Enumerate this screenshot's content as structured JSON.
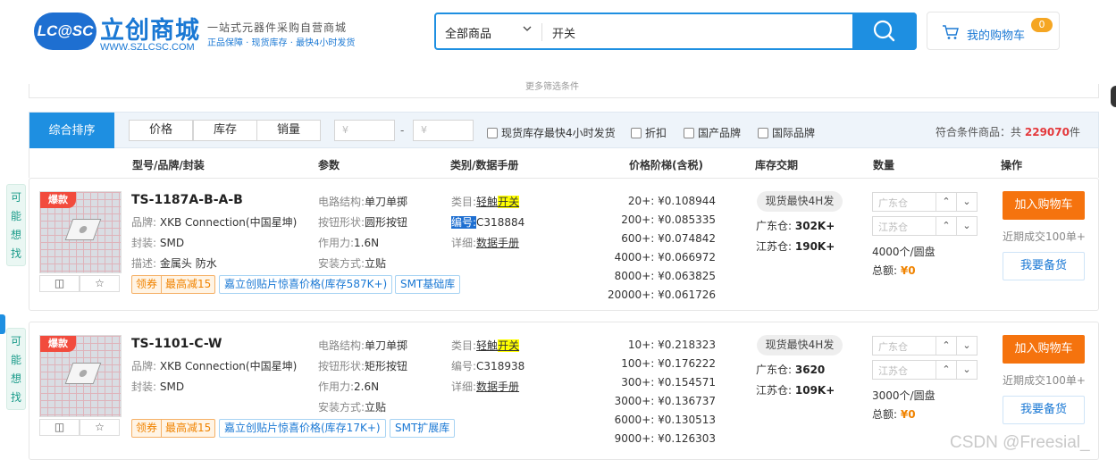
{
  "header": {
    "logo_text": "LC@SC",
    "brand_name": "立创商城",
    "url": "WWW.SZLCSC.COM",
    "slogan": "一站式元器件采购自营商城",
    "slogan_sub": "正品保障 · 现货库存 · 最快4小时发货"
  },
  "search": {
    "category": "全部商品",
    "keyword": "开关"
  },
  "cart": {
    "label": "我的购物车",
    "count": "0"
  },
  "subbar": {
    "more_filters": "更多筛选条件"
  },
  "sortbar": {
    "active": "综合排序",
    "sort_options": [
      "价格",
      "库存",
      "销量"
    ],
    "price_from_placeholder": "¥",
    "price_to_placeholder": "¥",
    "dash": "-",
    "filters": [
      "现货库存最快4小时发货",
      "折扣",
      "国产品牌",
      "国际品牌"
    ],
    "total_prefix": "符合条件商品：共",
    "total_count": "229070",
    "total_suffix": "件"
  },
  "columns": [
    "型号/品牌/封装",
    "参数",
    "类别/数据手册",
    "价格阶梯(含税)",
    "库存交期",
    "数量",
    "操作"
  ],
  "side_panel": {
    "label_lines": [
      "可",
      "能",
      "想",
      "找"
    ]
  },
  "products": [
    {
      "hot": "爆款",
      "part_number": "TS-1187A-B-A-B",
      "brand_label": "品牌:",
      "brand": "XKB Connection(中国星坤)",
      "package_label": "封装:",
      "package": "SMD",
      "desc_label": "描述:",
      "desc": "金属头 防水",
      "params": [
        {
          "k": "电路结构:",
          "v": "单刀单掷"
        },
        {
          "k": "按钮形状:",
          "v": "圆形按钮"
        },
        {
          "k": "作用力:",
          "v": "1.6N"
        },
        {
          "k": "安装方式:",
          "v": "立贴"
        }
      ],
      "category_label": "类目:",
      "category_a": "轻触",
      "category_b": "开关",
      "code_label": "编号:",
      "code": "C318884",
      "datasheet_label": "详细:",
      "datasheet": "数据手册",
      "price_tiers": [
        "20+: ¥0.108944",
        "200+: ¥0.085335",
        "600+: ¥0.074842",
        "4000+: ¥0.066972",
        "8000+: ¥0.063825",
        "20000+: ¥0.061726"
      ],
      "stock_pill": "现货最快4H发",
      "gd_label": "广东仓:",
      "gd_stock": "302K+",
      "js_label": "江苏仓:",
      "js_stock": "190K+",
      "qty_gd_placeholder": "广东仓",
      "qty_js_placeholder": "江苏仓",
      "pack": "4000个/圆盘",
      "sum_label": "总额:",
      "sum": "¥0",
      "coupon_a": "领券",
      "coupon_b": "最高减15",
      "tag1": "嘉立创贴片惊喜价格(库存587K+)",
      "tag2": "SMT基础库",
      "add_cart": "加入购物车",
      "recent": "近期成交100单+",
      "prebook": "我要备货"
    },
    {
      "hot": "爆款",
      "part_number": "TS-1101-C-W",
      "brand_label": "品牌:",
      "brand": "XKB Connection(中国星坤)",
      "package_label": "封装:",
      "package": "SMD",
      "params": [
        {
          "k": "电路结构:",
          "v": "单刀单掷"
        },
        {
          "k": "按钮形状:",
          "v": "矩形按钮"
        },
        {
          "k": "作用力:",
          "v": "2.6N"
        },
        {
          "k": "安装方式:",
          "v": "立贴"
        }
      ],
      "category_label": "类目:",
      "category_a": "轻触",
      "category_b": "开关",
      "code_label": "编号:",
      "code": "C318938",
      "datasheet_label": "详细:",
      "datasheet": "数据手册",
      "price_tiers": [
        "10+: ¥0.218323",
        "100+: ¥0.176222",
        "300+: ¥0.154571",
        "3000+: ¥0.136737",
        "6000+: ¥0.130513",
        "9000+: ¥0.126303"
      ],
      "stock_pill": "现货最快4H发",
      "gd_label": "广东仓:",
      "gd_stock": "3620",
      "js_label": "江苏仓:",
      "js_stock": "109K+",
      "qty_gd_placeholder": "广东仓",
      "qty_js_placeholder": "江苏仓",
      "pack": "3000个/圆盘",
      "sum_label": "总额:",
      "sum": "¥0",
      "coupon_a": "领券",
      "coupon_b": "最高减15",
      "tag1": "嘉立创贴片惊喜价格(库存17K+)",
      "tag2": "SMT扩展库",
      "add_cart": "加入购物车",
      "recent": "近期成交100单+",
      "prebook": "我要备货"
    }
  ],
  "watermark": "CSDN @Freesial_",
  "colors": {
    "brand_blue": "#1e8fe1",
    "orange": "#f5730e",
    "hot_red": "#f24b3d"
  }
}
